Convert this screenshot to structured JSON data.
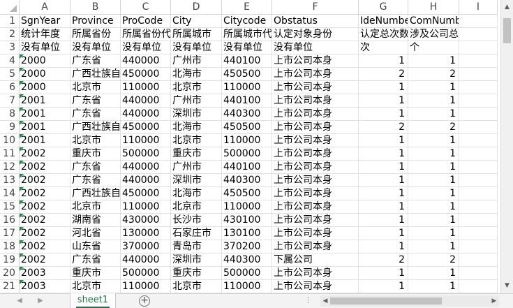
{
  "columns": [
    "A",
    "B",
    "C",
    "D",
    "E",
    "F",
    "G",
    "H",
    "I"
  ],
  "rows": [
    {
      "n": "1",
      "cells": [
        "SgnYear",
        "Province",
        "ProCode",
        "City",
        "Citycode",
        "Obstatus",
        "IdeNumber",
        "ComNumber",
        ""
      ]
    },
    {
      "n": "2",
      "cells": [
        "统计年度",
        "所属省份",
        "所属省份代码",
        "所属城市",
        "所属城市代码",
        "认定对象身份",
        "认定总次数",
        "涉及公司总数量",
        ""
      ]
    },
    {
      "n": "3",
      "cells": [
        "没有单位",
        "没有单位",
        "没有单位",
        "没有单位",
        "没有单位",
        "没有单位",
        "次",
        "个",
        ""
      ]
    },
    {
      "n": "4",
      "cells": [
        "2000",
        "广东省",
        "440000",
        "广州市",
        "440100",
        "上市公司本身",
        "1",
        "1",
        ""
      ]
    },
    {
      "n": "5",
      "cells": [
        "2000",
        "广西壮族自治区",
        "450000",
        "北海市",
        "450500",
        "上市公司本身",
        "2",
        "2",
        ""
      ]
    },
    {
      "n": "6",
      "cells": [
        "2000",
        "北京市",
        "110000",
        "北京市",
        "110000",
        "上市公司本身",
        "1",
        "1",
        ""
      ]
    },
    {
      "n": "7",
      "cells": [
        "2001",
        "广东省",
        "440000",
        "广州市",
        "440100",
        "上市公司本身",
        "1",
        "1",
        ""
      ]
    },
    {
      "n": "8",
      "cells": [
        "2001",
        "广东省",
        "440000",
        "深圳市",
        "440300",
        "上市公司本身",
        "1",
        "1",
        ""
      ]
    },
    {
      "n": "9",
      "cells": [
        "2001",
        "广西壮族自治区",
        "450000",
        "北海市",
        "450500",
        "上市公司本身",
        "2",
        "2",
        ""
      ]
    },
    {
      "n": "10",
      "cells": [
        "2001",
        "北京市",
        "110000",
        "北京市",
        "110000",
        "上市公司本身",
        "1",
        "1",
        ""
      ]
    },
    {
      "n": "11",
      "cells": [
        "2002",
        "重庆市",
        "500000",
        "重庆市",
        "500000",
        "上市公司本身",
        "1",
        "1",
        ""
      ]
    },
    {
      "n": "12",
      "cells": [
        "2002",
        "广东省",
        "440000",
        "广州市",
        "440100",
        "上市公司本身",
        "1",
        "1",
        ""
      ]
    },
    {
      "n": "13",
      "cells": [
        "2002",
        "广东省",
        "440000",
        "深圳市",
        "440300",
        "上市公司本身",
        "1",
        "1",
        ""
      ]
    },
    {
      "n": "14",
      "cells": [
        "2002",
        "广西壮族自治区",
        "450000",
        "北海市",
        "450500",
        "上市公司本身",
        "1",
        "1",
        ""
      ]
    },
    {
      "n": "15",
      "cells": [
        "2002",
        "北京市",
        "110000",
        "北京市",
        "110000",
        "上市公司本身",
        "1",
        "1",
        ""
      ]
    },
    {
      "n": "16",
      "cells": [
        "2002",
        "湖南省",
        "430000",
        "长沙市",
        "430100",
        "上市公司本身",
        "1",
        "1",
        ""
      ]
    },
    {
      "n": "17",
      "cells": [
        "2002",
        "河北省",
        "130000",
        "石家庄市",
        "130100",
        "上市公司本身",
        "1",
        "1",
        ""
      ]
    },
    {
      "n": "18",
      "cells": [
        "2002",
        "山东省",
        "370000",
        "青岛市",
        "370200",
        "上市公司本身",
        "1",
        "1",
        ""
      ]
    },
    {
      "n": "19",
      "cells": [
        "2002",
        "广东省",
        "440000",
        "深圳市",
        "440300",
        "下属公司",
        "2",
        "2",
        ""
      ]
    },
    {
      "n": "20",
      "cells": [
        "2003",
        "重庆市",
        "500000",
        "重庆市",
        "500000",
        "上市公司本身",
        "1",
        "1",
        ""
      ]
    },
    {
      "n": "21",
      "cells": [
        "2003",
        "北京市",
        "110000",
        "北京市",
        "110000",
        "上市公司本身",
        "1",
        "1",
        ""
      ]
    }
  ],
  "sheet_tab": "sheet1",
  "add_sheet_glyph": "+",
  "ellipsis": "⋮",
  "accent_color": "#217346",
  "flag_color": "#1e8c3e"
}
